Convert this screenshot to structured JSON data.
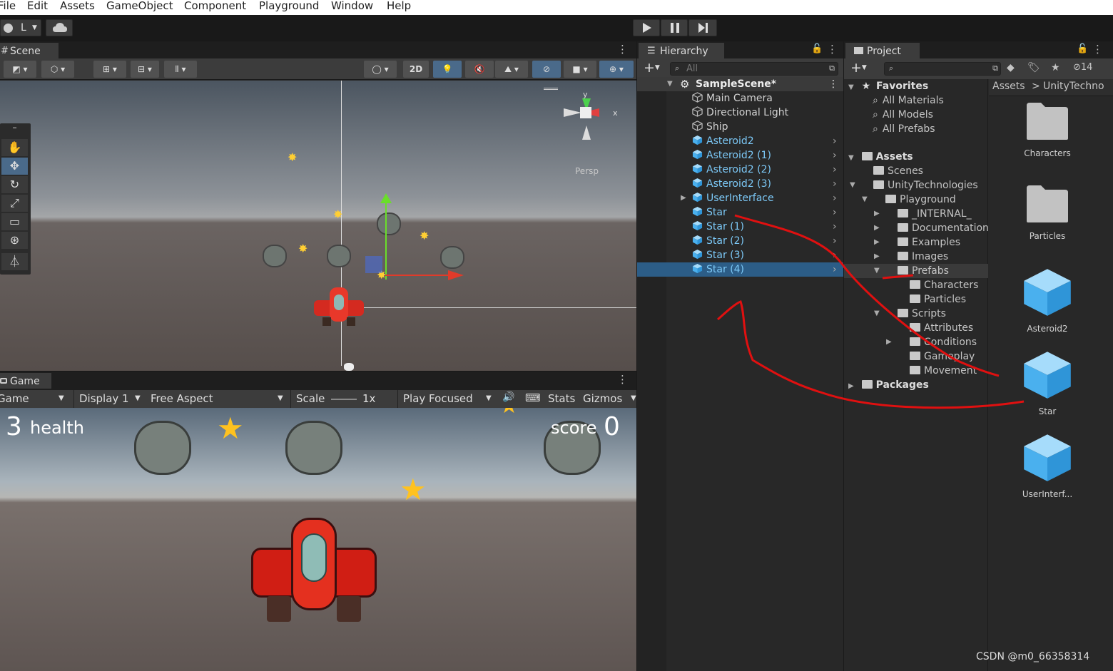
{
  "menu": [
    "File",
    "Edit",
    "Assets",
    "GameObject",
    "Component",
    "Playground",
    "Window",
    "Help"
  ],
  "toolbar": {
    "account_label": "L",
    "play_icon": "play-icon",
    "pause_icon": "pause-icon",
    "step_icon": "step-icon"
  },
  "scene": {
    "tab": "Scene",
    "btn_2d": "2D",
    "persp": "Persp",
    "gizmo_y": "y",
    "gizmo_x": "x"
  },
  "game": {
    "tab": "Game",
    "view_label": "Game",
    "display": "Display 1",
    "aspect": "Free Aspect",
    "scale_label": "Scale",
    "scale_value": "1x",
    "play_focused": "Play Focused",
    "stats": "Stats",
    "gizmos": "Gizmos",
    "health_num": "3",
    "health_label": "health",
    "score_label": "score",
    "score_num": "0"
  },
  "hierarchy": {
    "tab": "Hierarchy",
    "search_placeholder": "All",
    "scene_name": "SampleScene*",
    "items": [
      {
        "label": "Main Camera",
        "prefab": false
      },
      {
        "label": "Directional Light",
        "prefab": false
      },
      {
        "label": "Ship",
        "prefab": false
      },
      {
        "label": "Asteroid2",
        "prefab": true
      },
      {
        "label": "Asteroid2 (1)",
        "prefab": true
      },
      {
        "label": "Asteroid2 (2)",
        "prefab": true
      },
      {
        "label": "Asteroid2 (3)",
        "prefab": true
      },
      {
        "label": "UserInterface",
        "prefab": true
      },
      {
        "label": "Star",
        "prefab": true
      },
      {
        "label": "Star (1)",
        "prefab": true
      },
      {
        "label": "Star (2)",
        "prefab": true
      },
      {
        "label": "Star (3)",
        "prefab": true
      },
      {
        "label": "Star (4)",
        "prefab": true,
        "selected": true
      }
    ]
  },
  "project": {
    "tab": "Project",
    "hidden_count": "14",
    "breadcrumb": [
      "Assets",
      "UnityTechno"
    ],
    "favorites_label": "Favorites",
    "favorites": [
      "All Materials",
      "All Models",
      "All Prefabs"
    ],
    "assets_label": "Assets",
    "tree": [
      {
        "label": "Scenes",
        "level": 1
      },
      {
        "label": "UnityTechnologies",
        "level": 1
      },
      {
        "label": "Playground",
        "level": 2
      },
      {
        "label": "_INTERNAL_",
        "level": 3
      },
      {
        "label": "Documentation",
        "level": 3
      },
      {
        "label": "Examples",
        "level": 3
      },
      {
        "label": "Images",
        "level": 3
      },
      {
        "label": "Prefabs",
        "level": 3
      },
      {
        "label": "Characters",
        "level": 4
      },
      {
        "label": "Particles",
        "level": 4
      },
      {
        "label": "Scripts",
        "level": 3
      },
      {
        "label": "Attributes",
        "level": 4
      },
      {
        "label": "Conditions",
        "level": 4
      },
      {
        "label": "Gameplay",
        "level": 4
      },
      {
        "label": "Movement",
        "level": 4
      }
    ],
    "packages_label": "Packages",
    "grid": [
      {
        "label": "Characters",
        "kind": "folder"
      },
      {
        "label": "Particles",
        "kind": "folder"
      },
      {
        "label": "Asteroid2",
        "kind": "prefab"
      },
      {
        "label": "Star",
        "kind": "prefab"
      },
      {
        "label": "UserInterf...",
        "kind": "prefab"
      }
    ]
  },
  "watermark": "CSDN @m0_66358314",
  "colors": {
    "prefab_text": "#7cc8f6",
    "selection": "#2c5d87",
    "annotation": "#e01010"
  }
}
